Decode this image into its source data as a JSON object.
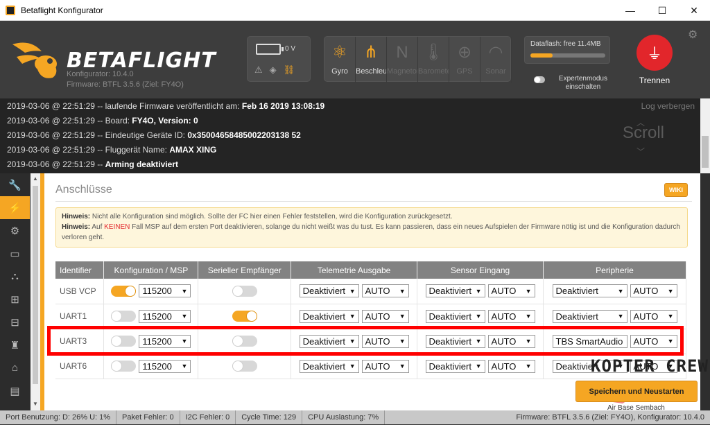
{
  "window": {
    "title": "Betaflight Konfigurator",
    "minimize": "—",
    "maximize": "☐",
    "close": "✕"
  },
  "header": {
    "logo_text": "BETAFLIGHT",
    "configurator_version": "Konfigurator: 10.4.0",
    "firmware_version": "Firmware: BTFL 3.5.6 (Ziel: FY4O)",
    "battery_voltage": "0 V",
    "sensors": [
      {
        "label": "Gyro",
        "icon": "gyro-icon",
        "active": true,
        "glyph": "⚛"
      },
      {
        "label": "Beschleunigung",
        "icon": "accelerometer-icon",
        "active": true,
        "glyph": "⋔"
      },
      {
        "label": "Magnetometer",
        "icon": "magnetometer-icon",
        "active": false,
        "glyph": "N"
      },
      {
        "label": "Barometer",
        "icon": "barometer-icon",
        "active": false,
        "glyph": "🌡"
      },
      {
        "label": "GPS",
        "icon": "gps-icon",
        "active": false,
        "glyph": "⊕"
      },
      {
        "label": "Sonar",
        "icon": "sonar-icon",
        "active": false,
        "glyph": "◠"
      }
    ],
    "dataflash_label": "Dataflash: free 11.4MB",
    "dataflash_fill": 0.3,
    "expert_mode_label": "Expertenmodus einschalten",
    "disconnect_label": "Trennen"
  },
  "log": {
    "hide_label": "Log verbergen",
    "scroll_label": "Scroll",
    "lines": [
      {
        "prefix": "2019-03-06 @ 22:51:29 -- laufende Firmware veröffentlicht am: ",
        "value": "Feb 16 2019 13:08:19"
      },
      {
        "prefix": "2019-03-06 @ 22:51:29 -- Board: ",
        "value": "FY4O, Version: 0"
      },
      {
        "prefix": "2019-03-06 @ 22:51:29 -- Eindeutige Geräte ID: ",
        "value": "0x35004658485002203138 52"
      },
      {
        "prefix": "2019-03-06 @ 22:51:29 -- Fluggerät Name: ",
        "value": "AMAX XING"
      },
      {
        "prefix": "2019-03-06 @ 22:51:29 -- ",
        "value": "Arming deaktiviert"
      }
    ]
  },
  "sidebar": {
    "items": [
      {
        "icon": "wrench-icon",
        "glyph": "🔧",
        "active": false
      },
      {
        "icon": "ports-plug-icon",
        "glyph": "⚡",
        "active": true
      },
      {
        "icon": "gear-icon",
        "glyph": "⚙",
        "active": false
      },
      {
        "icon": "power-icon",
        "glyph": "▭",
        "active": false
      },
      {
        "icon": "failsafe-icon",
        "glyph": "⛬",
        "active": false
      },
      {
        "icon": "pid-robot-icon",
        "glyph": "⊞",
        "active": false
      },
      {
        "icon": "receiver-icon",
        "glyph": "⊟",
        "active": false
      },
      {
        "icon": "modes-icon",
        "glyph": "♜",
        "active": false
      },
      {
        "icon": "adjustments-icon",
        "glyph": "⌂",
        "active": false
      },
      {
        "icon": "osd-icon",
        "glyph": "▤",
        "active": false
      },
      {
        "icon": "blackbox-icon",
        "glyph": "▥",
        "active": false
      }
    ]
  },
  "content": {
    "title": "Anschlüsse",
    "wiki_label": "WIKI",
    "note": {
      "label1": "Hinweis:",
      "text1": " Nicht alle Konfiguration sind möglich. Sollte der FC hier einen Fehler feststellen, wird die Konfiguration zurückgesetzt.",
      "label2": "Hinweis:",
      "text2a": " Auf ",
      "text2red": "KEINEN",
      "text2b": " Fall MSP auf dem ersten Port deaktivieren, solange du nicht weißt was du tust. Es kann passieren, dass ein neues Aufspielen der Firmware nötig ist und die Konfiguration dadurch verloren geht."
    },
    "columns": [
      "Identifier",
      "Konfiguration / MSP",
      "Serieller Empfänger",
      "Telemetrie Ausgabe",
      "Sensor Eingang",
      "Peripherie"
    ],
    "rows": [
      {
        "id": "USB VCP",
        "msp": true,
        "baud": "115200",
        "serial_rx": false,
        "telemetry": "Deaktiviert",
        "telemetry_baud": "AUTO",
        "sensor": "Deaktiviert",
        "sensor_baud": "AUTO",
        "peripheral": "Deaktiviert",
        "peripheral_baud": "AUTO"
      },
      {
        "id": "UART1",
        "msp": false,
        "baud": "115200",
        "serial_rx": true,
        "telemetry": "Deaktiviert",
        "telemetry_baud": "AUTO",
        "sensor": "Deaktiviert",
        "sensor_baud": "AUTO",
        "peripheral": "Deaktiviert",
        "peripheral_baud": "AUTO"
      },
      {
        "id": "UART3",
        "msp": false,
        "baud": "115200",
        "serial_rx": false,
        "telemetry": "Deaktiviert",
        "telemetry_baud": "AUTO",
        "sensor": "Deaktiviert",
        "sensor_baud": "AUTO",
        "peripheral": "TBS SmartAudio",
        "peripheral_baud": "AUTO"
      },
      {
        "id": "UART6",
        "msp": false,
        "baud": "115200",
        "serial_rx": false,
        "telemetry": "Deaktiviert",
        "telemetry_baud": "AUTO",
        "sensor": "Deaktiviert",
        "sensor_baud": "AUTO",
        "peripheral": "Deaktiviert",
        "peripheral_baud": "AUTO"
      }
    ],
    "save_button": "Speichern und Neustarten"
  },
  "watermark": {
    "brand": "KOPTER CREW",
    "sub": "Air Base Sembach"
  },
  "statusbar": {
    "port_usage": "Port Benutzung: D: 26% U: 1%",
    "packet_errors": "Paket Fehler: 0",
    "i2c_errors": "I2C Fehler: 0",
    "cycle_time": "Cycle Time: 129",
    "cpu_load": "CPU Auslastung: 7%",
    "version": "Firmware: BTFL 3.5.6 (Ziel: FY4O), Konfigurator: 10.4.0"
  },
  "colors": {
    "accent": "#f5a623",
    "danger": "#e2262b",
    "highlight": "#ff0000"
  }
}
